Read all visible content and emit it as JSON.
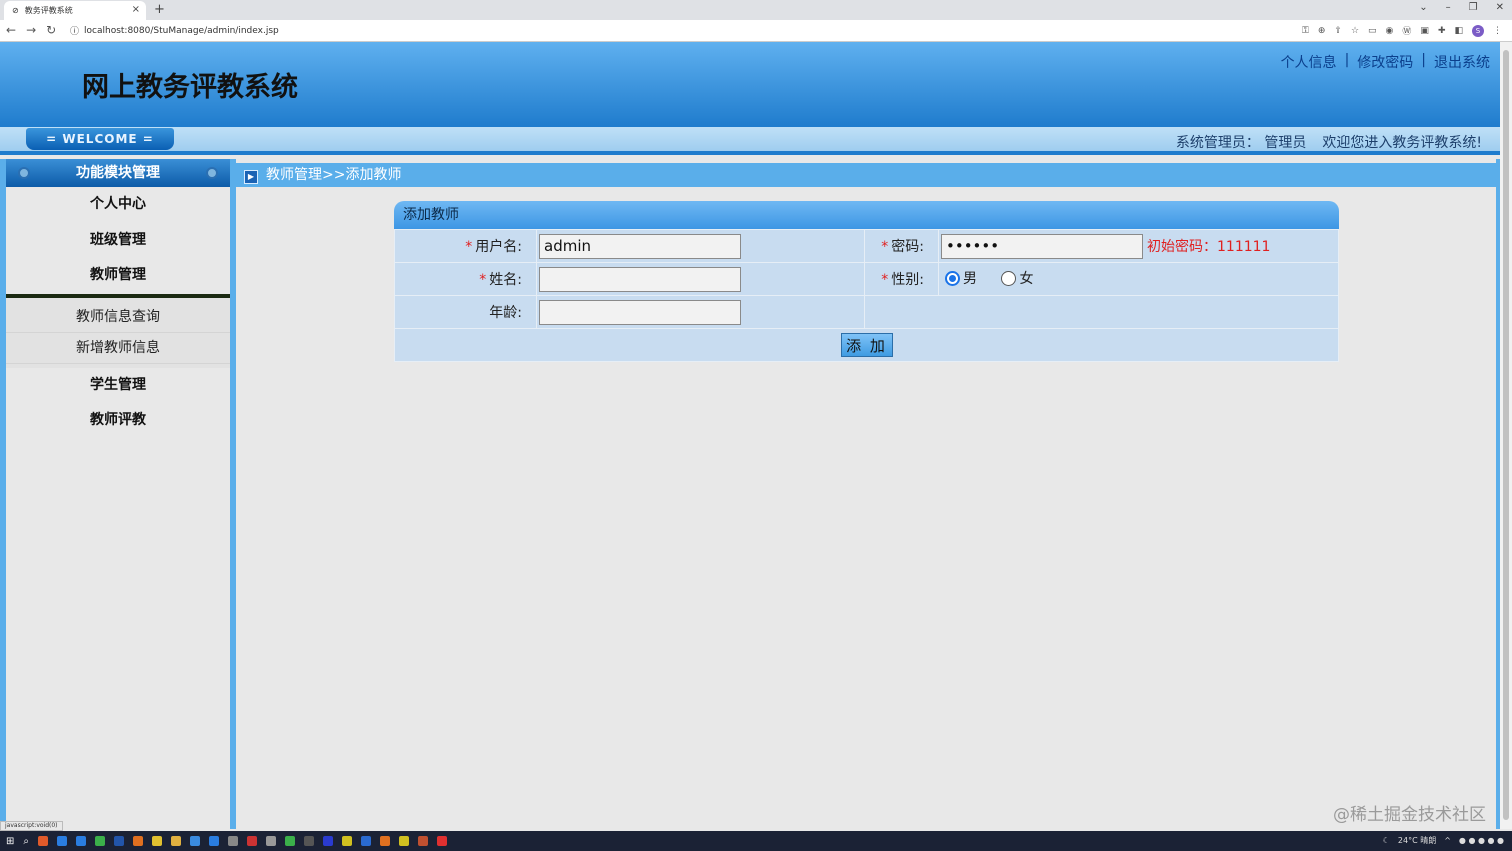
{
  "browser": {
    "tab_title": "教务评教系统",
    "tab_close": "×",
    "new_tab": "+",
    "url": "localhost:8080/StuManage/admin/index.jsp",
    "status_text": "javascript:void(0)"
  },
  "header": {
    "system_title": "网上教务评教系统",
    "links": {
      "profile": "个人信息",
      "change_password": "修改密码",
      "logout": "退出系统",
      "separator": "|"
    },
    "welcome_badge": "= WELCOME =",
    "user_role": "系统管理员：",
    "user_name": "管理员",
    "welcome_message": "欢迎您进入教务评教系统!"
  },
  "sidebar": {
    "title": "功能模块管理",
    "items": [
      {
        "label": "个人中心"
      },
      {
        "label": "班级管理"
      },
      {
        "label": "教师管理"
      }
    ],
    "submenu": [
      {
        "label": "教师信息查询"
      },
      {
        "label": "新增教师信息"
      }
    ],
    "items_after": [
      {
        "label": "学生管理"
      },
      {
        "label": "教师评教"
      }
    ]
  },
  "breadcrumb": "教师管理>>添加教师",
  "form": {
    "title": "添加教师",
    "required_mark": "*",
    "username_label": "用户名:",
    "username_value": "admin",
    "password_label": "密码:",
    "password_value": "••••••",
    "password_hint": "初始密码：111111",
    "name_label": "姓名:",
    "name_value": "",
    "gender_label": "性别:",
    "gender_options": [
      "男",
      "女"
    ],
    "gender_selected": "男",
    "age_label": "年龄:",
    "age_value": "",
    "submit_label": "添 加"
  },
  "watermark": "@稀土掘金技术社区",
  "taskbar": {
    "weather": "24°C 晴朗"
  },
  "colors": {
    "header_top": "#5fb0ef",
    "header_bottom": "#1f7ccd",
    "frame_blue": "#5aaeea",
    "form_bg": "#c8dcf0",
    "required_red": "#e02020"
  }
}
